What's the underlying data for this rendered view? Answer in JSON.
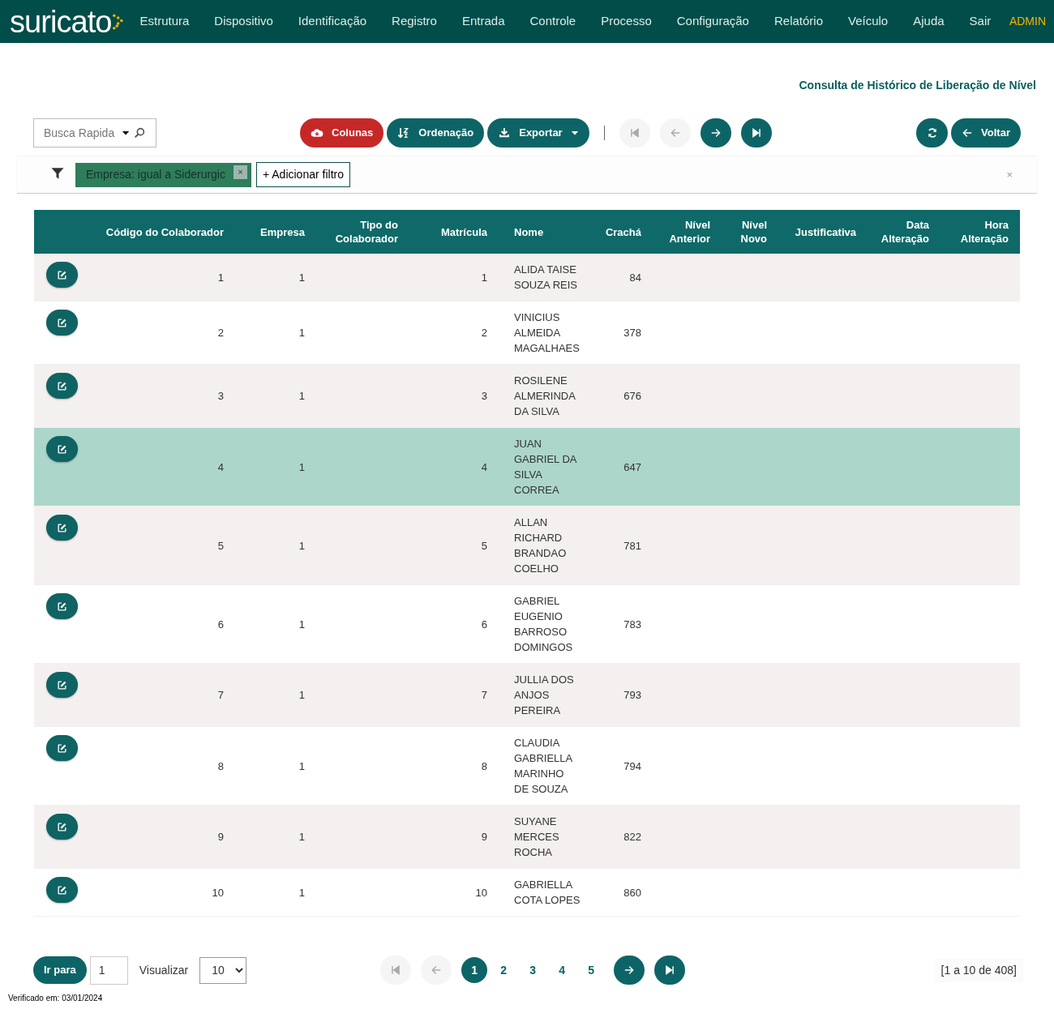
{
  "header": {
    "logo": "suricato",
    "menu": [
      "Estrutura",
      "Dispositivo",
      "Identificação",
      "Registro",
      "Entrada",
      "Controle",
      "Processo",
      "Configuração",
      "Relatório",
      "Veículo",
      "Ajuda",
      "Sair"
    ],
    "user": "ADMIN"
  },
  "page_title": "Consulta de Histórico de Liberação de Nível",
  "toolbar": {
    "search": {
      "placeholder": "Busca Rapida"
    },
    "buttons": [
      {
        "kind": "columns",
        "label": "Colunas"
      },
      {
        "kind": "sort",
        "label": "Ordenação"
      },
      {
        "kind": "export",
        "label": "Exportar"
      }
    ],
    "nav": [
      {
        "kind": "first",
        "disabled": true
      },
      {
        "kind": "prev",
        "disabled": true
      },
      {
        "kind": "next",
        "disabled": false
      },
      {
        "kind": "last",
        "disabled": false
      }
    ],
    "refresh": {
      "kind": "refresh"
    },
    "back": {
      "label": "Voltar"
    }
  },
  "filters": {
    "chips": [
      {
        "label": "Empresa: igual a Siderurgic",
        "remove": "×"
      }
    ],
    "add": "+ Adicionar filtro",
    "clear": "×"
  },
  "table": {
    "columns": [
      "",
      "Código do Colaborador",
      "Empresa",
      "Tipo do Colaborador",
      "Matrícula",
      "Nome",
      "Crachá",
      "Nível Anterior",
      "Nível Novo",
      "Justificativa",
      "Data Alteração",
      "Hora Alteração"
    ],
    "rows": [
      {
        "selected": false,
        "cells": [
          "",
          "1",
          "1",
          "",
          "1",
          "ALIDA TAISE SOUZA REIS",
          "84",
          "",
          "",
          "",
          "",
          ""
        ]
      },
      {
        "selected": false,
        "cells": [
          "",
          "2",
          "1",
          "",
          "2",
          "VINICIUS ALMEIDA MAGALHAES",
          "378",
          "",
          "",
          "",
          "",
          ""
        ]
      },
      {
        "selected": false,
        "cells": [
          "",
          "3",
          "1",
          "",
          "3",
          "ROSILENE ALMERINDA DA SILVA",
          "676",
          "",
          "",
          "",
          "",
          ""
        ]
      },
      {
        "selected": true,
        "cells": [
          "",
          "4",
          "1",
          "",
          "4",
          "JUAN GABRIEL DA SILVA CORREA",
          "647",
          "",
          "",
          "",
          "",
          ""
        ]
      },
      {
        "selected": false,
        "cells": [
          "",
          "5",
          "1",
          "",
          "5",
          "ALLAN RICHARD BRANDAO COELHO",
          "781",
          "",
          "",
          "",
          "",
          ""
        ]
      },
      {
        "selected": false,
        "cells": [
          "",
          "6",
          "1",
          "",
          "6",
          "GABRIEL EUGENIO BARROSO DOMINGOS",
          "783",
          "",
          "",
          "",
          "",
          ""
        ]
      },
      {
        "selected": false,
        "cells": [
          "",
          "7",
          "1",
          "",
          "7",
          "JULLIA DOS ANJOS PEREIRA",
          "793",
          "",
          "",
          "",
          "",
          ""
        ]
      },
      {
        "selected": false,
        "cells": [
          "",
          "8",
          "1",
          "",
          "8",
          "CLAUDIA GABRIELLA MARINHO DE SOUZA",
          "794",
          "",
          "",
          "",
          "",
          ""
        ]
      },
      {
        "selected": false,
        "cells": [
          "",
          "9",
          "1",
          "",
          "9",
          "SUYANE MERCES ROCHA",
          "822",
          "",
          "",
          "",
          "",
          ""
        ]
      },
      {
        "selected": false,
        "cells": [
          "",
          "10",
          "1",
          "",
          "10",
          "GABRIELLA COTA LOPES",
          "860",
          "",
          "",
          "",
          "",
          ""
        ]
      }
    ]
  },
  "footer": {
    "goto": {
      "label": "Ir para",
      "value": "1"
    },
    "view": {
      "label": "Visualizar",
      "value": "10"
    },
    "pager": {
      "nav": [
        {
          "kind": "first",
          "disabled": true
        },
        {
          "kind": "prev",
          "disabled": true
        },
        {
          "kind": "next",
          "disabled": false
        },
        {
          "kind": "last",
          "disabled": false
        }
      ],
      "pages": [
        {
          "label": "1",
          "selected": true
        },
        {
          "label": "2",
          "selected": false
        },
        {
          "label": "3",
          "selected": false
        },
        {
          "label": "4",
          "selected": false
        },
        {
          "label": "5",
          "selected": false
        }
      ]
    },
    "range": "[1 a 10 de 408]"
  },
  "verified": "Verificado em: 03/01/2024"
}
